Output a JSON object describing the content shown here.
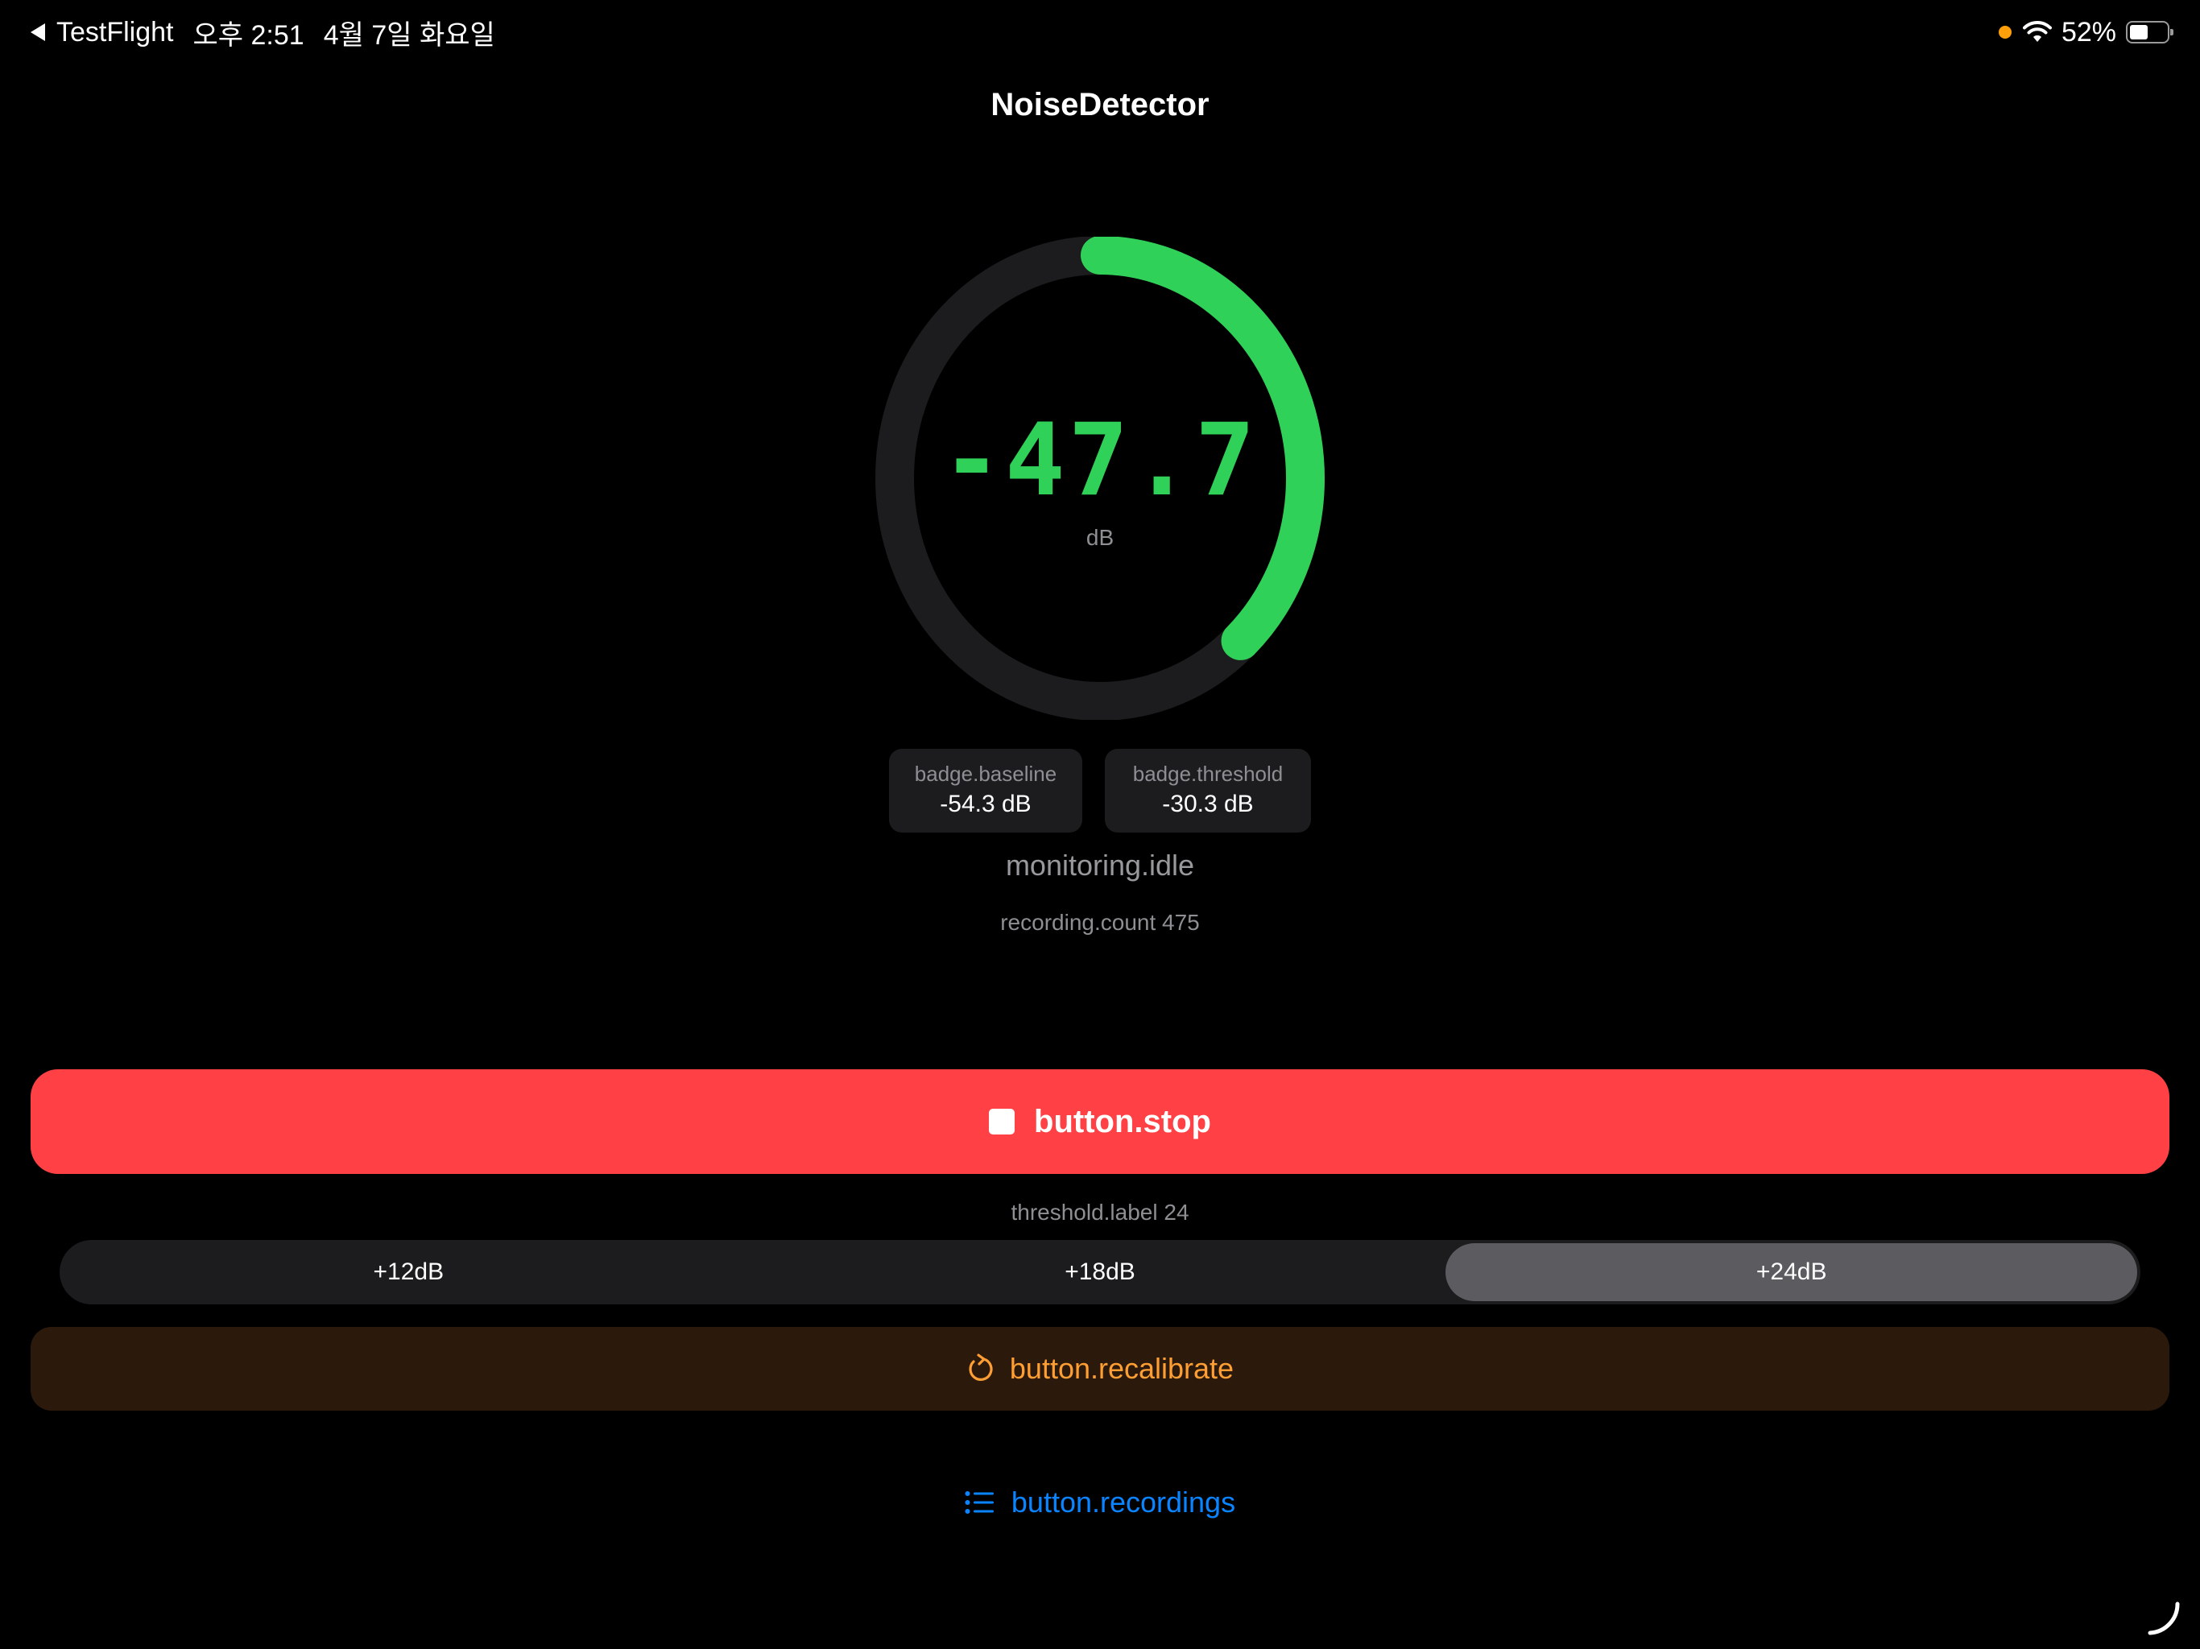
{
  "status_bar": {
    "back_app": "TestFlight",
    "time": "오후 2:51",
    "date": "4월 7일 화요일",
    "battery_percent": "52%",
    "battery_level": 0.52
  },
  "header": {
    "title": "NoiseDetector"
  },
  "gauge": {
    "value": "-47.7",
    "unit": "dB",
    "fill_fraction": 0.38,
    "active_color": "#30d158",
    "track_color": "#1c1c1e"
  },
  "badges": [
    {
      "label": "badge.baseline",
      "value": "-54.3 dB"
    },
    {
      "label": "badge.threshold",
      "value": "-30.3 dB"
    }
  ],
  "status": {
    "monitoring": "monitoring.idle",
    "recording_count": "recording.count 475"
  },
  "stop_button": {
    "label": "button.stop",
    "color": "#ff4045"
  },
  "threshold": {
    "label": "threshold.label 24",
    "options": [
      "+12dB",
      "+18dB",
      "+24dB"
    ],
    "selected_index": 2
  },
  "recalibrate_button": {
    "label": "button.recalibrate",
    "color": "#ff9f33"
  },
  "recordings_button": {
    "label": "button.recordings",
    "color": "#0a84ff"
  }
}
